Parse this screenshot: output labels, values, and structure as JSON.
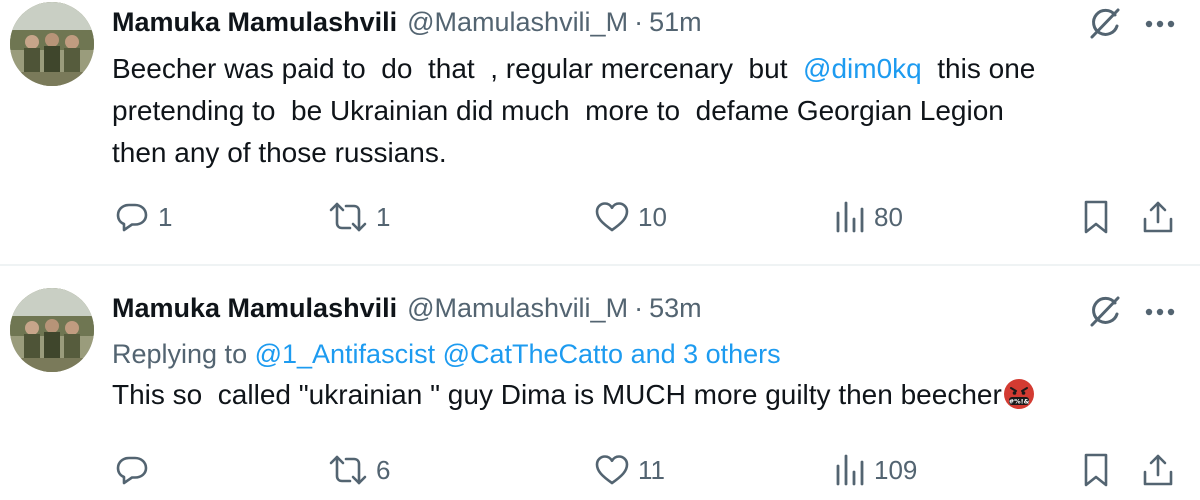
{
  "tweets": [
    {
      "author_name": "Mamuka Mamulashvili",
      "handle": "@Mamulashvili_M",
      "separator": "·",
      "time": "51m",
      "text_parts": {
        "line1_a": "Beecher was paid to  do  that  , regular mercenary  but  ",
        "mention": "@dim0kq",
        "line1_b": "  this one",
        "line2": "pretending to  be Ukrainian did much  more to  defame Georgian Legion",
        "line3": "then any of those russians."
      },
      "stats": {
        "replies": "1",
        "reposts": "1",
        "likes": "10",
        "views": "80"
      }
    },
    {
      "author_name": "Mamuka Mamulashvili",
      "handle": "@Mamulashvili_M",
      "separator": "·",
      "time": "53m",
      "replying_to": {
        "prefix": "Replying to ",
        "users": "@1_Antifascist @CatTheCatto and 3 others"
      },
      "text": "This so  called \"ukrainian \" guy Dima is MUCH more guilty then beecher",
      "emoji": "face-with-symbols-on-mouth",
      "stats": {
        "replies": "",
        "reposts": "6",
        "likes": "11",
        "views": "109"
      }
    }
  ],
  "colors": {
    "text": "#0f1419",
    "secondary": "#536471",
    "link": "#1d9bf0",
    "divider": "#eff3f4"
  }
}
